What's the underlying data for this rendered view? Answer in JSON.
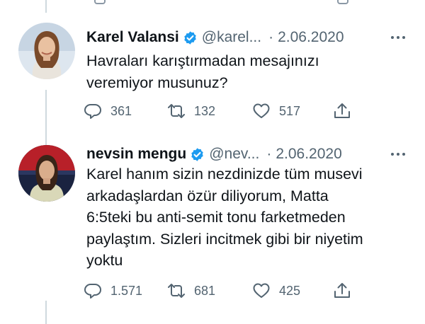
{
  "colors": {
    "text": "#0f1419",
    "secondary": "#536471",
    "verified": "#1d9bf0",
    "thread_line": "#cfd9de"
  },
  "tweets": [
    {
      "author": "Karel Valansi",
      "verified_icon": "verified-badge-icon",
      "handle": "@karel...",
      "dot": "·",
      "date": "2.06.2020",
      "text_lines": [
        "Havraları karıştırmadan mesajınızı",
        "veremiyor musunuz?"
      ],
      "reply_count": "361",
      "retweet_count": "132",
      "like_count": "517"
    },
    {
      "author": "nevsin mengu",
      "verified_icon": "verified-badge-icon",
      "handle": "@nev...",
      "dot": "·",
      "date": "2.06.2020",
      "text_lines": [
        "Karel hanım sizin nezdinizde tüm musevi",
        "arkadaşlardan özür diliyorum, Matta",
        "6:5teki bu anti-semit tonu farketmeden",
        "paylaştım. Sizleri incitmek gibi bir niyetim",
        "yoktu"
      ],
      "reply_count": "1.571",
      "retweet_count": "681",
      "like_count": "425"
    }
  ],
  "icons": {
    "reply": "reply-icon",
    "retweet": "retweet-icon",
    "like": "heart-icon",
    "share": "share-icon",
    "more": "more-icon"
  }
}
